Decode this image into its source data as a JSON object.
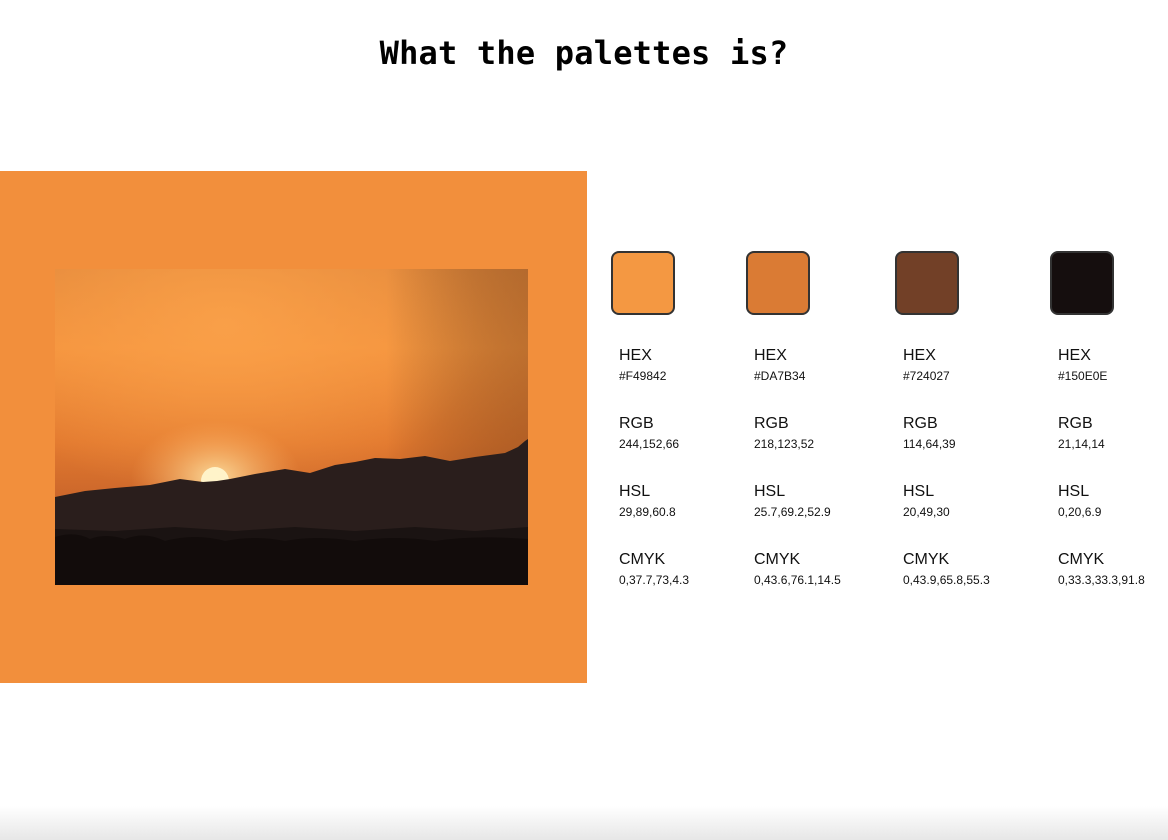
{
  "page": {
    "title": "What the palettes is?"
  },
  "image": {
    "description_icon": "sunset-photo-icon",
    "panel_color": "#F28F3C"
  },
  "palette": [
    {
      "swatch_color": "#F49842",
      "hex_label": "HEX",
      "hex": "#F49842",
      "rgb_label": "RGB",
      "rgb": "244,152,66",
      "hsl_label": "HSL",
      "hsl": "29,89,60.8",
      "cmyk_label": "CMYK",
      "cmyk": "0,37.7,73,4.3"
    },
    {
      "swatch_color": "#DA7B34",
      "hex_label": "HEX",
      "hex": "#DA7B34",
      "rgb_label": "RGB",
      "rgb": "218,123,52",
      "hsl_label": "HSL",
      "hsl": "25.7,69.2,52.9",
      "cmyk_label": "CMYK",
      "cmyk": "0,43.6,76.1,14.5"
    },
    {
      "swatch_color": "#724027",
      "hex_label": "HEX",
      "hex": "#724027",
      "rgb_label": "RGB",
      "rgb": "114,64,39",
      "hsl_label": "HSL",
      "hsl": "20,49,30",
      "cmyk_label": "CMYK",
      "cmyk": "0,43.9,65.8,55.3"
    },
    {
      "swatch_color": "#150E0E",
      "hex_label": "HEX",
      "hex": "#150E0E",
      "rgb_label": "RGB",
      "rgb": "21,14,14",
      "hsl_label": "HSL",
      "hsl": "0,20,6.9",
      "cmyk_label": "CMYK",
      "cmyk": "0,33.3,33.3,91.8"
    }
  ]
}
